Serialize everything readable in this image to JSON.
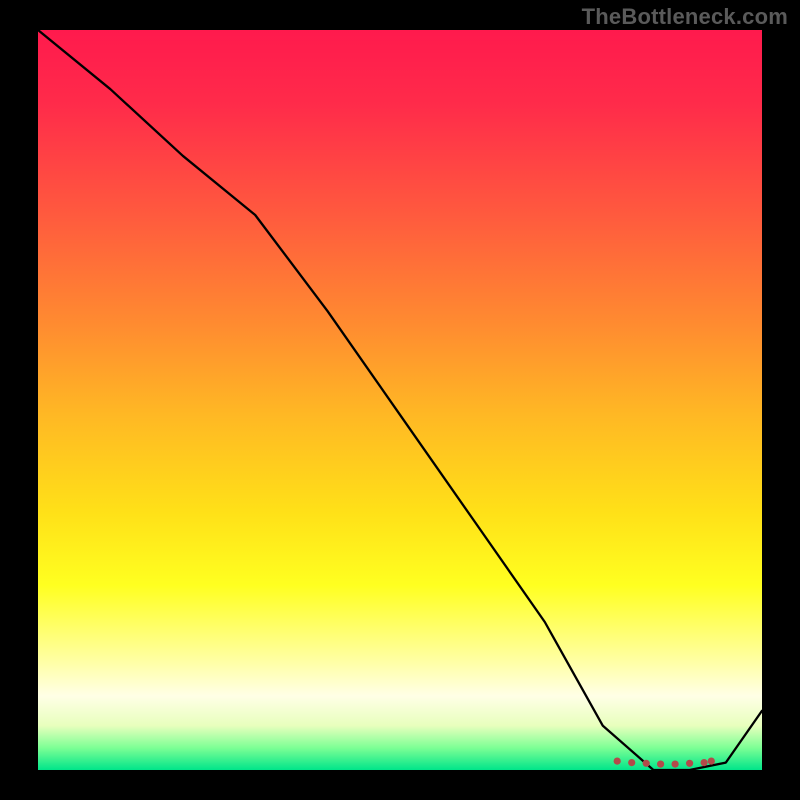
{
  "watermark": "TheBottleneck.com",
  "chart_data": {
    "type": "line",
    "title": "",
    "xlabel": "",
    "ylabel": "",
    "xlim": [
      0,
      100
    ],
    "ylim": [
      0,
      100
    ],
    "grid": false,
    "legend": false,
    "series": [
      {
        "name": "curve",
        "x": [
          0,
          10,
          20,
          30,
          40,
          50,
          60,
          70,
          78,
          85,
          90,
          95,
          100
        ],
        "y": [
          100,
          92,
          83,
          75,
          62,
          48,
          34,
          20,
          6,
          0,
          0,
          1,
          8
        ]
      }
    ],
    "markers": {
      "x": [
        80,
        82,
        84,
        86,
        88,
        90,
        92,
        93
      ],
      "y": [
        1.2,
        1.0,
        0.9,
        0.8,
        0.8,
        0.9,
        1.0,
        1.2
      ]
    },
    "background": "vertical gradient red→orange→yellow→green"
  }
}
